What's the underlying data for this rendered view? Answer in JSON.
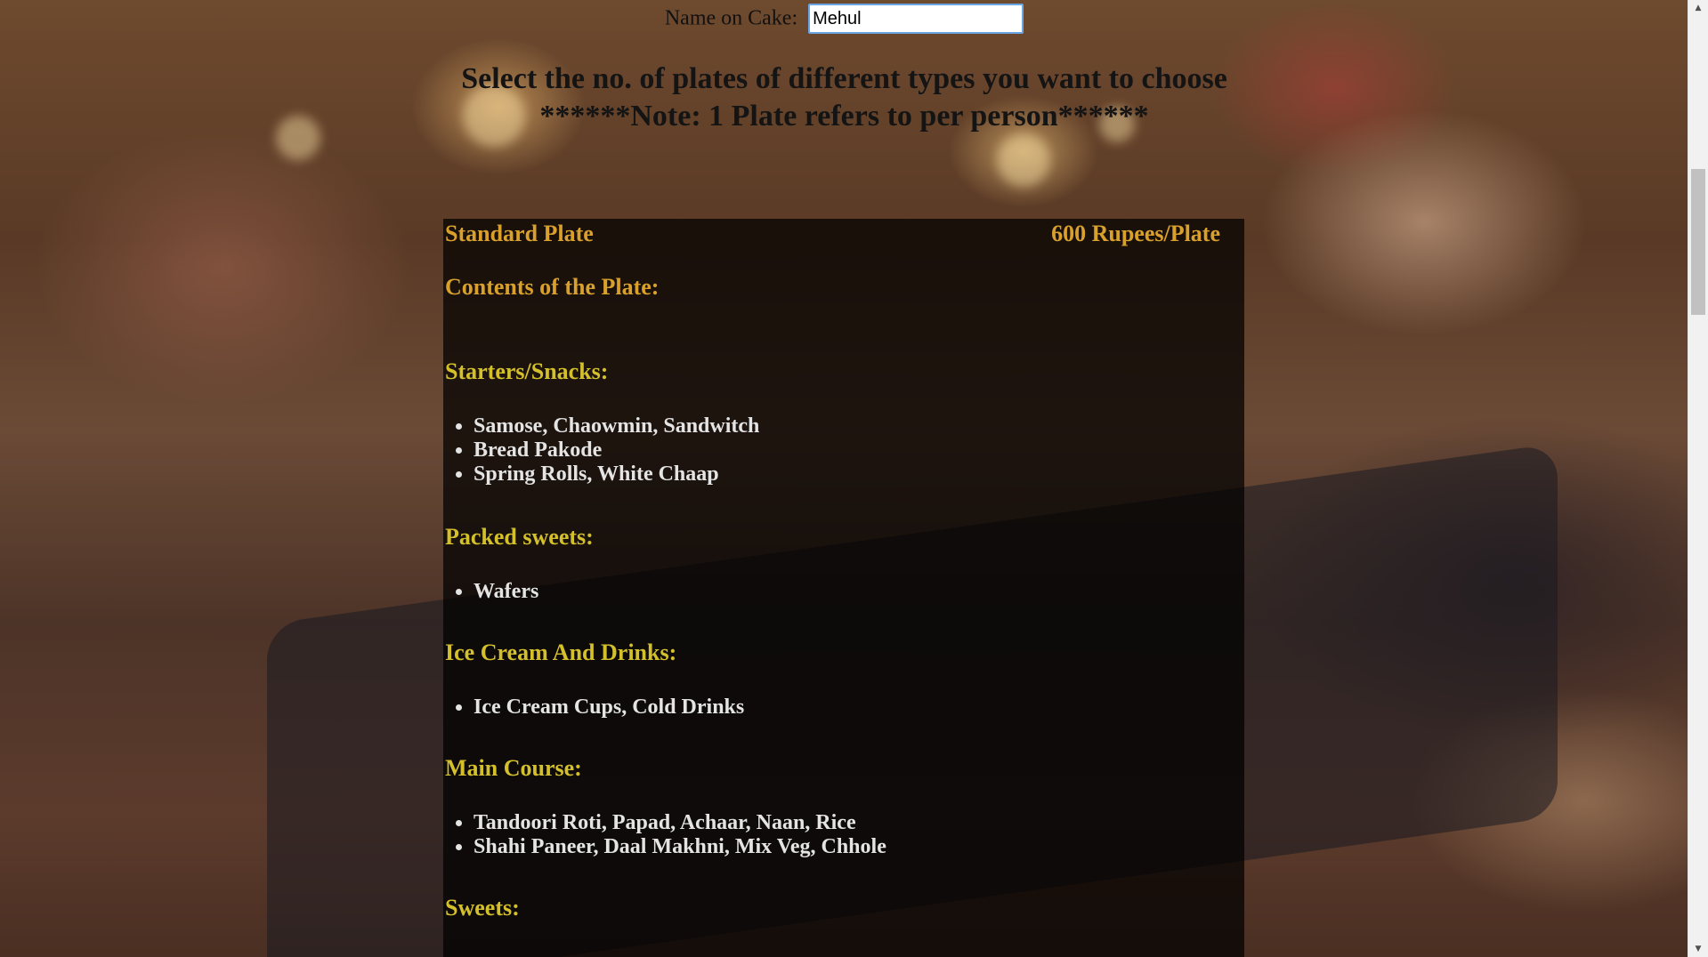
{
  "form": {
    "name_label": "Name on Cake:",
    "name_value": "Mehul"
  },
  "headline": {
    "line1": "Select the no. of plates of different types you want to choose",
    "line2": "******Note: 1 Plate refers to per person******"
  },
  "plate": {
    "name": "Standard Plate",
    "price": "600 Rupees/Plate",
    "contents_title": "Contents of the Plate:",
    "sections": [
      {
        "title": "Starters/Snacks:",
        "items": [
          "Samose, Chaowmin, Sandwitch",
          "Bread Pakode",
          "Spring Rolls, White Chaap"
        ]
      },
      {
        "title": "Packed sweets:",
        "items": [
          "Wafers"
        ]
      },
      {
        "title": "Ice Cream And Drinks:",
        "items": [
          "Ice Cream Cups, Cold Drinks"
        ]
      },
      {
        "title": "Main Course:",
        "items": [
          "Tandoori Roti, Papad, Achaar, Naan, Rice",
          "Shahi Paneer, Daal Makhni, Mix Veg, Chhole"
        ]
      },
      {
        "title": "Sweets:",
        "items": []
      }
    ]
  },
  "colors": {
    "plate_title": "#d9a12c",
    "section_title": "#d3c02a",
    "item_text": "#e4e4e4",
    "input_border": "#6aa6e6"
  },
  "icons": {
    "scroll_up": "triangle-up",
    "scroll_down": "triangle-down"
  }
}
